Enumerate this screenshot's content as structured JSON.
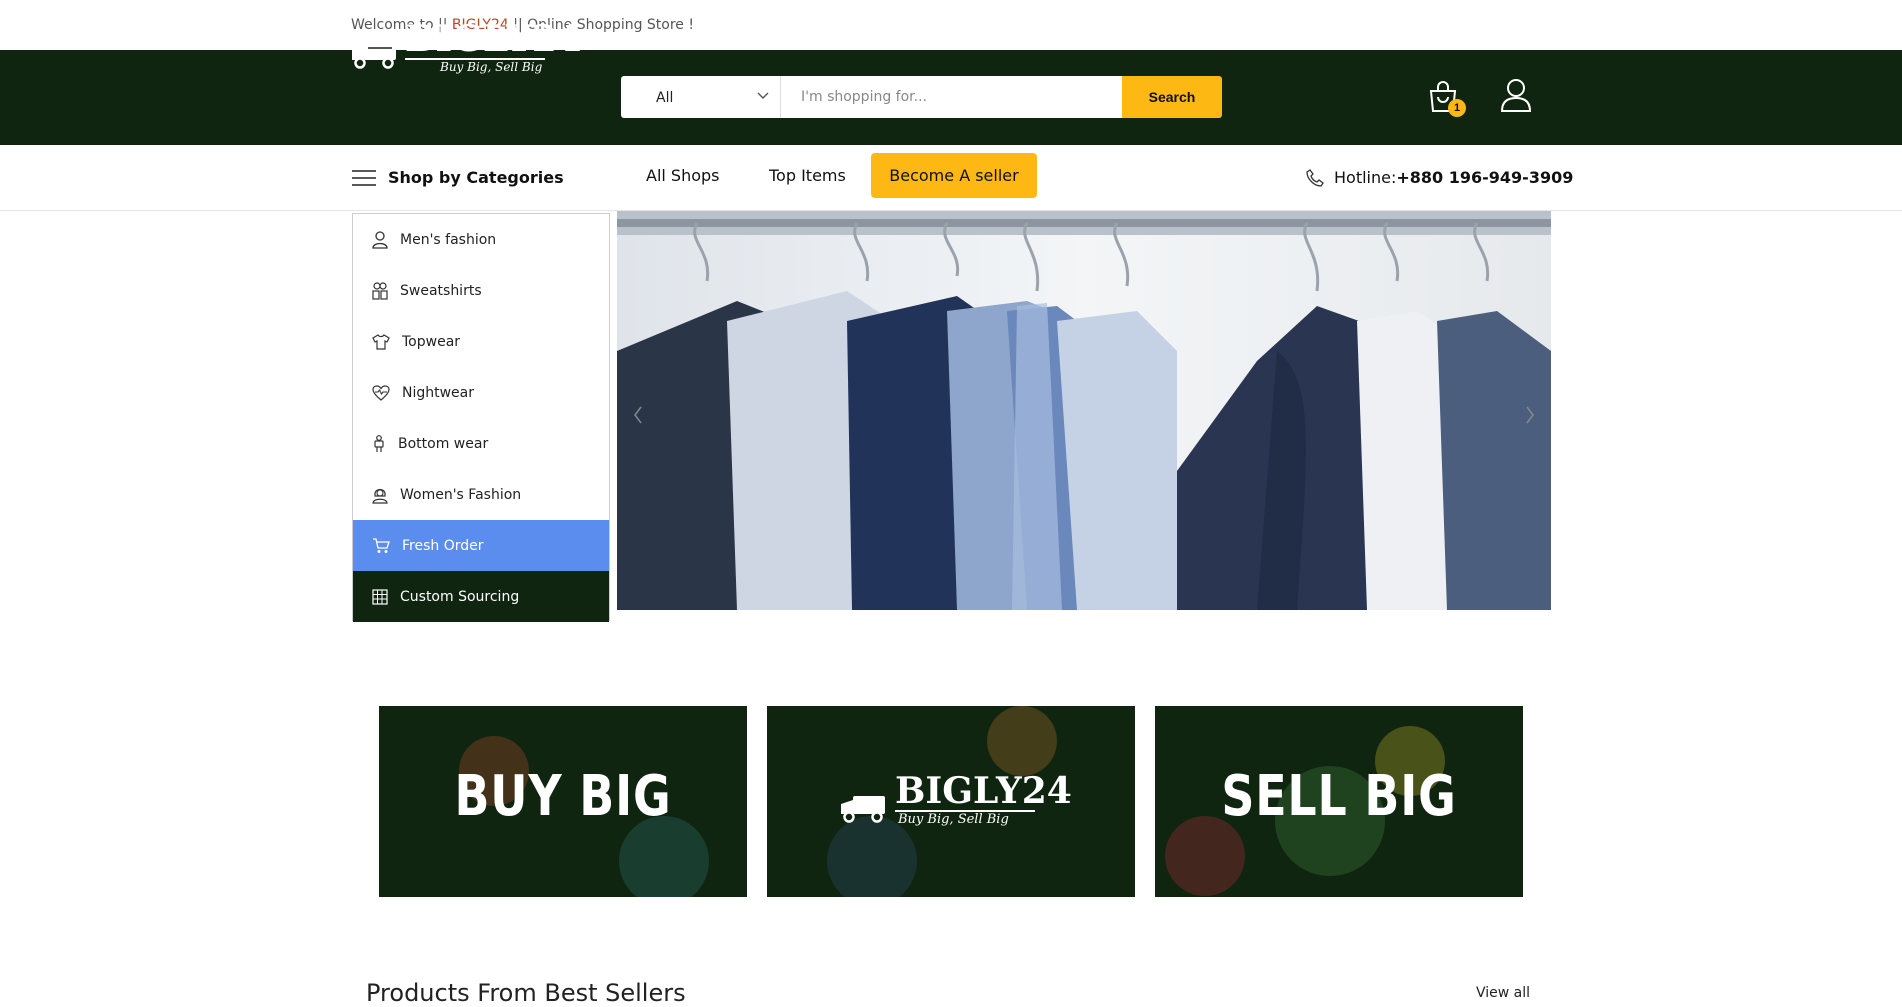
{
  "topbar": {
    "welcome_prefix": "Welcome to || ",
    "brand": "BIGLY24",
    "welcome_suffix": " || Online Shopping Store !"
  },
  "logo": {
    "word": "BIGLY24",
    "tagline": "Buy Big, Sell Big"
  },
  "search": {
    "category_selected": "All",
    "placeholder": "I'm shopping for...",
    "button_label": "Search"
  },
  "cart": {
    "count": "1"
  },
  "nav": {
    "shop_by_categories": "Shop by Categories",
    "links": [
      "All Shops",
      "Top Items"
    ],
    "seller_button": "Become A seller",
    "hotline_label": "Hotline:",
    "hotline_number": "+880 196-949-3909"
  },
  "categories": [
    {
      "label": "Men's fashion",
      "icon": "person-icon"
    },
    {
      "label": "Sweatshirts",
      "icon": "people-icon"
    },
    {
      "label": "Topwear",
      "icon": "tshirt-icon"
    },
    {
      "label": "Nightwear",
      "icon": "heart-pulse-icon"
    },
    {
      "label": "Bottom wear",
      "icon": "figure-icon"
    },
    {
      "label": "Women's Fashion",
      "icon": "woman-icon"
    },
    {
      "label": "Fresh Order",
      "icon": "cart-icon"
    },
    {
      "label": "Custom Sourcing",
      "icon": "grid-icon"
    }
  ],
  "tiles": {
    "left": "BUY BIG",
    "center_word": "BIGLY24",
    "center_tag": "Buy Big, Sell Big",
    "right": "SELL BIG"
  },
  "section": {
    "title": "Products From Best Sellers",
    "view_all": "View all"
  },
  "colors": {
    "header_bg": "#102510",
    "accent_yellow": "#fdb813",
    "active_blue": "#5b8def",
    "brand_red": "#b5462b"
  }
}
